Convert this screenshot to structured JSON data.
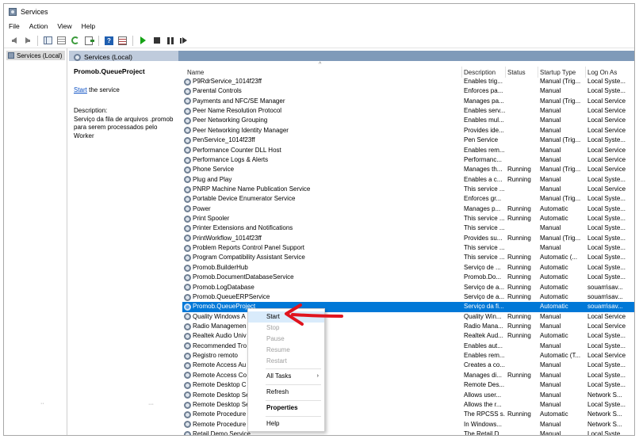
{
  "window": {
    "title": "Services",
    "menu": [
      "File",
      "Action",
      "View",
      "Help"
    ]
  },
  "left_pane": {
    "tree_label": "Services (Local)",
    "marks": [
      "··",
      "···"
    ]
  },
  "header": {
    "title": "Services (Local)"
  },
  "detail": {
    "service_name": "Promob.QueueProject",
    "start_link": "Start",
    "start_suffix": " the service",
    "desc_label": "Description:",
    "desc_text": "Serviço da fila de arquivos .promob para serem processados pelo Worker"
  },
  "columns": {
    "name": "Name",
    "description": "Description",
    "status": "Status",
    "startup": "Startup Type",
    "logon": "Log On As"
  },
  "services": [
    {
      "name": "P9RdrService_1014f23ff",
      "desc": "Enables trig...",
      "status": "",
      "startup": "Manual (Trig...",
      "logon": "Local Syste..."
    },
    {
      "name": "Parental Controls",
      "desc": "Enforces pa...",
      "status": "",
      "startup": "Manual",
      "logon": "Local Syste..."
    },
    {
      "name": "Payments and NFC/SE Manager",
      "desc": "Manages pa...",
      "status": "",
      "startup": "Manual (Trig...",
      "logon": "Local Service"
    },
    {
      "name": "Peer Name Resolution Protocol",
      "desc": "Enables serv...",
      "status": "",
      "startup": "Manual",
      "logon": "Local Service"
    },
    {
      "name": "Peer Networking Grouping",
      "desc": "Enables mul...",
      "status": "",
      "startup": "Manual",
      "logon": "Local Service"
    },
    {
      "name": "Peer Networking Identity Manager",
      "desc": "Provides ide...",
      "status": "",
      "startup": "Manual",
      "logon": "Local Service"
    },
    {
      "name": "PenService_1014f23ff",
      "desc": "Pen Service",
      "status": "",
      "startup": "Manual (Trig...",
      "logon": "Local Syste..."
    },
    {
      "name": "Performance Counter DLL Host",
      "desc": "Enables rem...",
      "status": "",
      "startup": "Manual",
      "logon": "Local Service"
    },
    {
      "name": "Performance Logs & Alerts",
      "desc": "Performanc...",
      "status": "",
      "startup": "Manual",
      "logon": "Local Service"
    },
    {
      "name": "Phone Service",
      "desc": "Manages th...",
      "status": "Running",
      "startup": "Manual (Trig...",
      "logon": "Local Service"
    },
    {
      "name": "Plug and Play",
      "desc": "Enables a c...",
      "status": "Running",
      "startup": "Manual",
      "logon": "Local Syste..."
    },
    {
      "name": "PNRP Machine Name Publication Service",
      "desc": "This service ...",
      "status": "",
      "startup": "Manual",
      "logon": "Local Service"
    },
    {
      "name": "Portable Device Enumerator Service",
      "desc": "Enforces gr...",
      "status": "",
      "startup": "Manual (Trig...",
      "logon": "Local Syste..."
    },
    {
      "name": "Power",
      "desc": "Manages p...",
      "status": "Running",
      "startup": "Automatic",
      "logon": "Local Syste..."
    },
    {
      "name": "Print Spooler",
      "desc": "This service ...",
      "status": "Running",
      "startup": "Automatic",
      "logon": "Local Syste..."
    },
    {
      "name": "Printer Extensions and Notifications",
      "desc": "This service ...",
      "status": "",
      "startup": "Manual",
      "logon": "Local Syste..."
    },
    {
      "name": "PrintWorkflow_1014f23ff",
      "desc": "Provides su...",
      "status": "Running",
      "startup": "Manual (Trig...",
      "logon": "Local Syste..."
    },
    {
      "name": "Problem Reports Control Panel Support",
      "desc": "This service ...",
      "status": "",
      "startup": "Manual",
      "logon": "Local Syste..."
    },
    {
      "name": "Program Compatibility Assistant Service",
      "desc": "This service ...",
      "status": "Running",
      "startup": "Automatic (...",
      "logon": "Local Syste..."
    },
    {
      "name": "Promob.BuilderHub",
      "desc": "Serviço de ...",
      "status": "Running",
      "startup": "Automatic",
      "logon": "Local Syste..."
    },
    {
      "name": "Promob.DocumentDatabaseService",
      "desc": "Promob.Do...",
      "status": "Running",
      "startup": "Automatic",
      "logon": "Local Syste..."
    },
    {
      "name": "Promob.LogDatabase",
      "desc": "Serviço de a...",
      "status": "Running",
      "startup": "Automatic",
      "logon": "souam\\sav..."
    },
    {
      "name": "Promob.QueueERPService",
      "desc": "Serviço de a...",
      "status": "Running",
      "startup": "Automatic",
      "logon": "souam\\sav..."
    },
    {
      "name": "Promob.QueueProject",
      "desc": "Serviço da fi...",
      "status": "",
      "startup": "Automatic",
      "logon": "souam\\sav...",
      "selected": true
    },
    {
      "name": "Quality Windows A",
      "desc": "Quality Win...",
      "status": "Running",
      "startup": "Manual",
      "logon": "Local Service"
    },
    {
      "name": "Radio Managemen",
      "desc": "Radio Mana...",
      "status": "Running",
      "startup": "Manual",
      "logon": "Local Service"
    },
    {
      "name": "Realtek Audio Univ",
      "desc": "Realtek Aud...",
      "status": "Running",
      "startup": "Automatic",
      "logon": "Local Syste..."
    },
    {
      "name": "Recommended Tro",
      "desc": "Enables aut...",
      "status": "",
      "startup": "Manual",
      "logon": "Local Syste..."
    },
    {
      "name": "Registro remoto",
      "desc": "Enables rem...",
      "status": "",
      "startup": "Automatic (T...",
      "logon": "Local Service"
    },
    {
      "name": "Remote Access Au",
      "desc": "Creates a co...",
      "status": "",
      "startup": "Manual",
      "logon": "Local Syste..."
    },
    {
      "name": "Remote Access Co",
      "desc": "Manages di...",
      "status": "Running",
      "startup": "Manual",
      "logon": "Local Syste..."
    },
    {
      "name": "Remote Desktop C",
      "desc": "Remote Des...",
      "status": "",
      "startup": "Manual",
      "logon": "Local Syste..."
    },
    {
      "name": "Remote Desktop Se",
      "desc": "Allows user...",
      "status": "",
      "startup": "Manual",
      "logon": "Network S..."
    },
    {
      "name": "Remote Desktop Se                                                  ctor",
      "desc": "Allows the r...",
      "status": "",
      "startup": "Manual",
      "logon": "Local Syste..."
    },
    {
      "name": "Remote Procedure",
      "desc": "The RPCSS s...",
      "status": "Running",
      "startup": "Automatic",
      "logon": "Network S..."
    },
    {
      "name": "Remote Procedure",
      "desc": "In Windows...",
      "status": "",
      "startup": "Manual",
      "logon": "Network S..."
    },
    {
      "name": "Retail Demo Service",
      "desc": "The Retail D...",
      "status": "",
      "startup": "Manual",
      "logon": "Local Syste..."
    }
  ],
  "context_menu": {
    "start": "Start",
    "stop": "Stop",
    "pause": "Pause",
    "resume": "Resume",
    "restart": "Restart",
    "all_tasks": "All Tasks",
    "refresh": "Refresh",
    "properties": "Properties",
    "help": "Help"
  },
  "colors": {
    "selection": "#0078d7",
    "annotation_arrow": "#e0141e"
  }
}
